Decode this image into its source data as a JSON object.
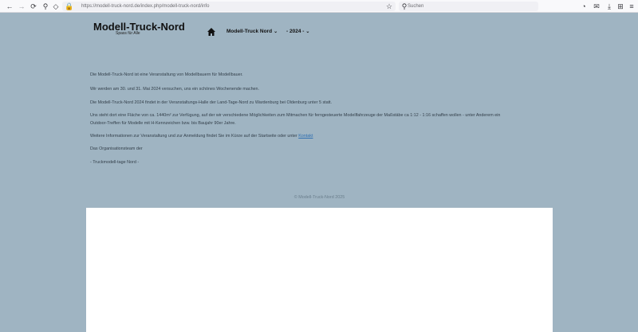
{
  "browser": {
    "url": "https://modell-truck-nord.de/index.php/modell-truck-nord/info",
    "search_placeholder": "Suchen"
  },
  "site": {
    "title": "Modell-Truck-Nord",
    "subtitle": "Spass für Alle",
    "nav": [
      {
        "label": "Modell-Truck Nord"
      },
      {
        "label": "- 2024 -"
      }
    ]
  },
  "content": {
    "paragraphs": [
      "Die Modell-Truck-Nord ist eine Veranstaltung von Modellbauern für Modellbauer.",
      "Wir werden am 30. und 31. Mai 2024 versuchen, uns ein schönes Wochenende machen.",
      "Die Modell-Truck-Nord 2024 findet in der Veranstaltungs-Halle der Land-Tage-Nord zu Wardenburg bei Oldenburg unter 5 statt.",
      "Uns steht dort eine Fläche von ca. 1440m² zur Verfügung, auf der wir verschiedene Möglichkeiten zum Mitmachen für ferngesteuerte Modellfahrzeuge der Maßstäbe ca 1:12 - 1:16 schaffen wollen - unter Anderem ein",
      "Outdoor-Treffen für Modelle mit H-Kennzeichen bzw. bis Baujahr 90er Jahre.",
      "Das Organisationsteam der",
      "- Truckmodell-tage Nord -"
    ],
    "info_text": "Weitere Informationen zur Veranstaltung und zur Anmeldung findet Sie im Kürze auf der Startseite oder unter",
    "info_link": "Kontakt",
    "footer": "© Modell-Truck-Nord 2025"
  }
}
